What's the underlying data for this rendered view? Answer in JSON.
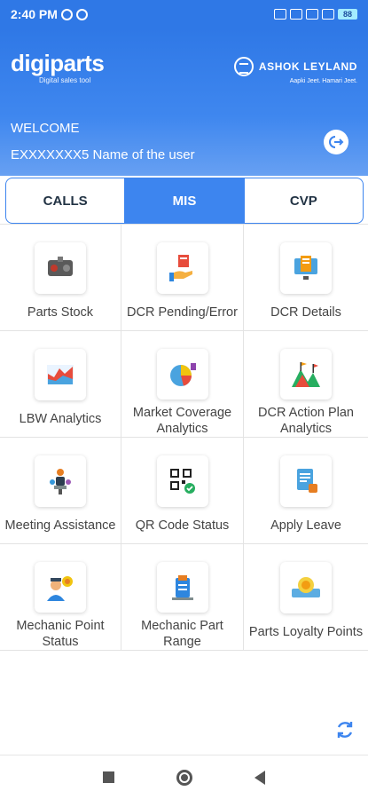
{
  "status_bar": {
    "time": "2:40 PM",
    "battery": "88"
  },
  "header": {
    "logo": "digiparts",
    "tagline": "Digital sales tool",
    "brand_name": "ASHOK LEYLAND",
    "brand_tagline": "Aapki Jeet. Hamari Jeet.",
    "welcome": "WELCOME",
    "user": "EXXXXXXX5 Name of the user"
  },
  "tabs": [
    {
      "label": "CALLS",
      "active": false
    },
    {
      "label": "MIS",
      "active": true
    },
    {
      "label": "CVP",
      "active": false
    }
  ],
  "tiles": [
    {
      "label": "Parts Stock",
      "icon": "engine-parts-icon"
    },
    {
      "label": "DCR Pending/Error",
      "icon": "pending-hand-icon"
    },
    {
      "label": "DCR Details",
      "icon": "monitor-report-icon"
    },
    {
      "label": "LBW Analytics",
      "icon": "area-chart-icon"
    },
    {
      "label": "Market Coverage Analytics",
      "icon": "pie-chart-icon"
    },
    {
      "label": "DCR Action Plan Analytics",
      "icon": "mountain-flags-icon"
    },
    {
      "label": "Meeting Assistance",
      "icon": "meeting-people-icon"
    },
    {
      "label": "QR Code Status",
      "icon": "qr-code-icon"
    },
    {
      "label": "Apply Leave",
      "icon": "leave-document-icon"
    },
    {
      "label": "Mechanic Point Status",
      "icon": "mechanic-medal-icon"
    },
    {
      "label": "Mechanic Part Range",
      "icon": "part-range-icon"
    },
    {
      "label": "Parts Loyalty Points",
      "icon": "loyalty-ribbon-icon"
    }
  ],
  "colors": {
    "primary": "#3d85ef",
    "header": "#2f78e6"
  }
}
